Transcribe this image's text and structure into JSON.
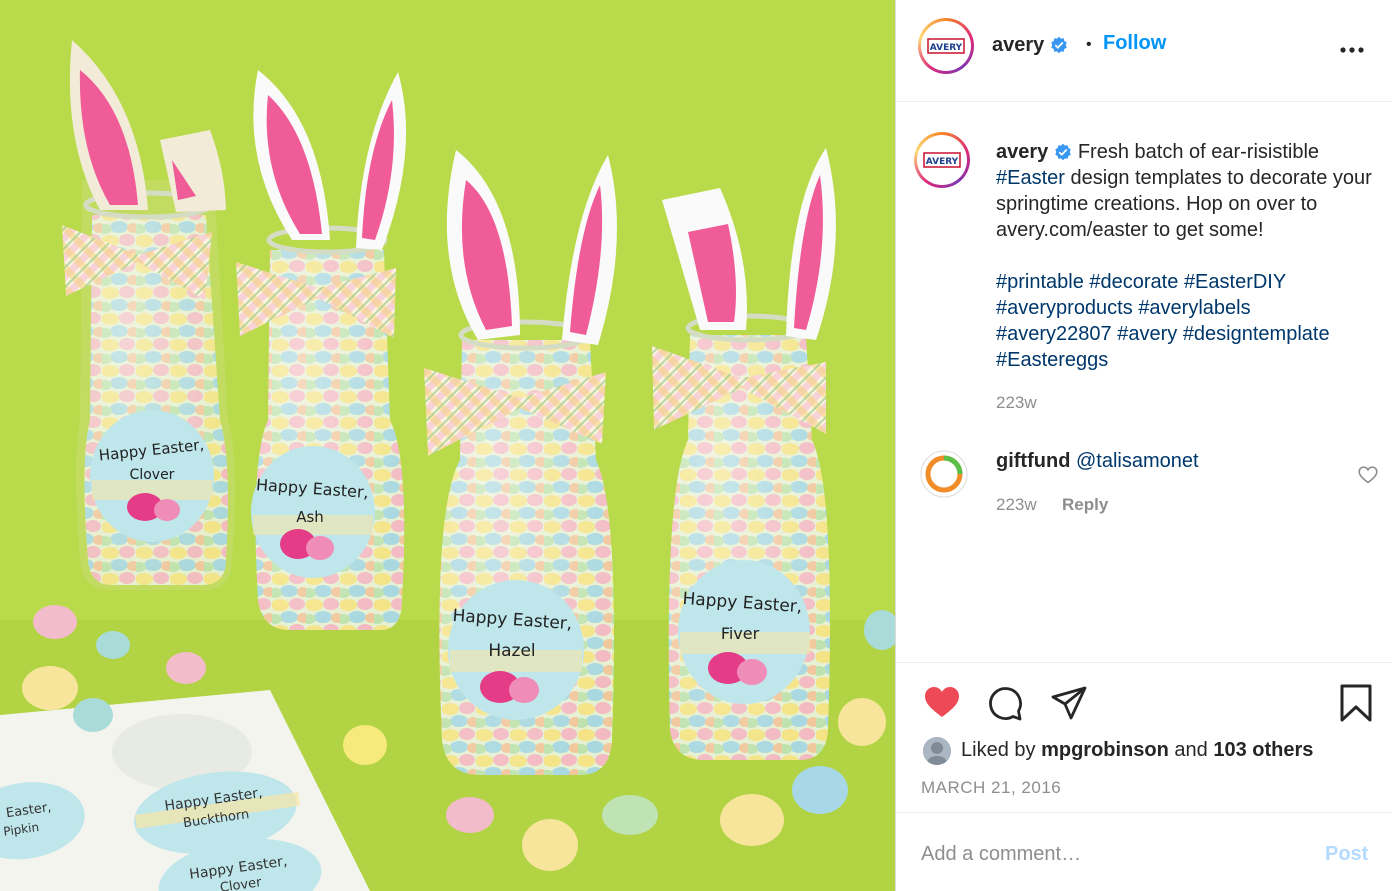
{
  "photo": {
    "bottle_labels": [
      {
        "line1": "Happy Easter,",
        "line2": "Clover"
      },
      {
        "line1": "Happy Easter,",
        "line2": "Ash"
      },
      {
        "line1": "Happy Easter,",
        "line2": "Hazel"
      },
      {
        "line1": "Happy Easter,",
        "line2": "Fiver"
      }
    ],
    "sheet_labels": [
      {
        "line1": "Happy Easter,",
        "line2": "Buckthorn"
      },
      {
        "line1": "Happy Easter,",
        "line2": "Clover"
      },
      {
        "line1": "Easter,",
        "line2": "Pipkin"
      }
    ],
    "background_color": "#b9da4a"
  },
  "header": {
    "username": "avery",
    "dot": "•",
    "follow_label": "Follow",
    "avatar_logo_text": "AVERY"
  },
  "caption": {
    "username": "avery",
    "text_part1": "Fresh batch of ear-risistible",
    "hashtag_easter": "#Easter",
    "text_part2": "design templates to decorate your springtime creations. Hop on over to avery.com/easter to get some!",
    "hashtags": [
      "#printable",
      "#decorate",
      "#EasterDIY",
      "#averyproducts",
      "#averylabels",
      "#avery22807",
      "#avery",
      "#designtemplate",
      "#Eastereggs"
    ],
    "time": "223w"
  },
  "comment": {
    "username": "giftfund",
    "mention": "@talisamonet",
    "time": "223w",
    "reply_label": "Reply"
  },
  "actions": {
    "liked_by_prefix": "Liked by",
    "liked_by_user": "mpgrobinson",
    "and_text": "and",
    "others": "103 others",
    "date": "MARCH 21, 2016",
    "like_color": "#ed4956"
  },
  "add_comment": {
    "placeholder": "Add a comment…",
    "post_label": "Post"
  },
  "colors": {
    "link_blue": "#0095f6",
    "hashtag_blue": "#00376b",
    "post_disabled": "#b3dbff",
    "secondary_text": "#8e8e8e"
  }
}
